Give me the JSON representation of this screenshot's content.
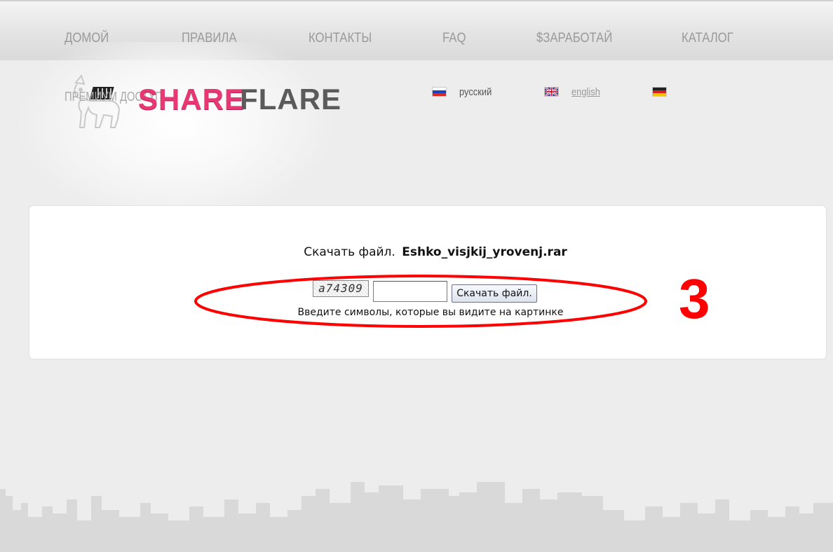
{
  "nav": {
    "items": [
      {
        "label": "ДОМОЙ"
      },
      {
        "label": "ПРАВИЛА"
      },
      {
        "label": "КОНТАКТЫ"
      },
      {
        "label": "FAQ"
      },
      {
        "label": "$ЗАРАБОТАЙ"
      },
      {
        "label": "КАТАЛОГ"
      }
    ]
  },
  "logo": {
    "premium_text": "ПРЕМИУМ ДОСТУП",
    "brand_part1": "SHARE",
    "brand_part2": "FLARE"
  },
  "languages": [
    {
      "label": "русский",
      "flag": "flag-ru-icon"
    },
    {
      "label": "english",
      "flag": "flag-gb-icon"
    },
    {
      "label": "",
      "flag": "flag-de-icon"
    }
  ],
  "download": {
    "prefix": "Скачать файл.",
    "filename": "Eshko_visjkij_yrovenj.rar",
    "captcha_text": "a74309",
    "input_value": "",
    "button_label": "Скачать файл.",
    "hint": "Введите символы, которые вы видите на картинке"
  },
  "annotation": {
    "step": "3",
    "color": "#ff0000"
  },
  "colors": {
    "brand_pink": "#e63973",
    "brand_gray": "#5b5b5b",
    "background": "#ededed"
  }
}
